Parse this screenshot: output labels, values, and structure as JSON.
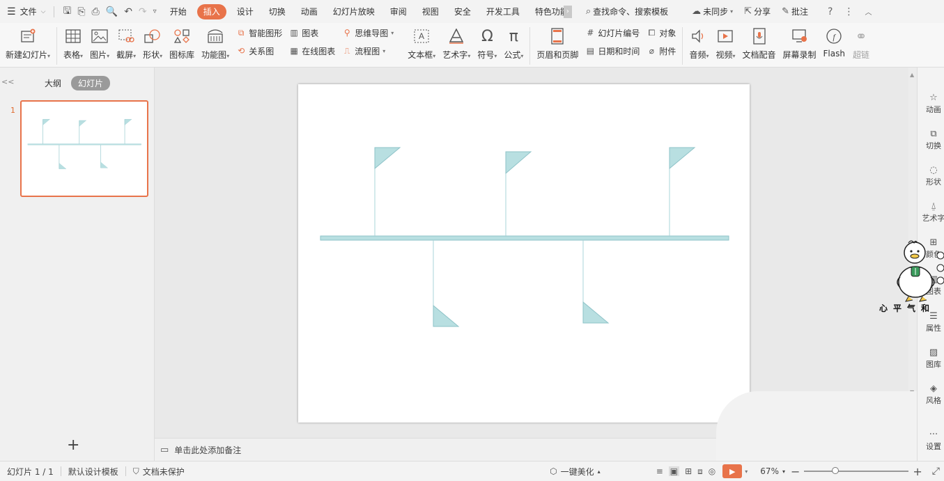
{
  "menubar": {
    "file_label": "文件",
    "tabs": [
      "开始",
      "插入",
      "设计",
      "切换",
      "动画",
      "幻灯片放映",
      "审阅",
      "视图",
      "安全",
      "开发工具",
      "特色功能"
    ],
    "active_tab": "插入",
    "search_label": "查找命令、搜索模板",
    "sync_label": "未同步",
    "share_label": "分享",
    "comment_label": "批注"
  },
  "ribbon": {
    "new_slide": "新建幻灯片",
    "table": "表格",
    "picture": "图片",
    "screenshot": "截屏",
    "shape": "形状",
    "icon_lib": "图标库",
    "function_chart": "功能图",
    "smart_art": "智能图形",
    "chart": "图表",
    "relation": "关系图",
    "online_chart": "在线图表",
    "mind_map": "思维导图",
    "flowchart": "流程图",
    "textbox": "文本框",
    "art_text": "艺术字",
    "symbol": "符号",
    "formula": "公式",
    "header_footer": "页眉和页脚",
    "slide_number": "幻灯片编号",
    "object": "对象",
    "datetime": "日期和时间",
    "attachment": "附件",
    "audio": "音频",
    "video": "视频",
    "doc_dub": "文档配音",
    "screen_rec": "屏幕录制",
    "flash": "Flash",
    "hyperlink": "超链"
  },
  "leftpanel": {
    "collapse_glyph": "<<",
    "tab_outline": "大纲",
    "tab_slides": "幻灯片",
    "slide_number": "1",
    "add_glyph": "+"
  },
  "notes": {
    "placeholder": "单击此处添加备注"
  },
  "rightbar": {
    "items": [
      "动画",
      "切换",
      "形状",
      "艺术字",
      "颜色",
      "图表",
      "属性",
      "图库",
      "风格",
      "设置"
    ]
  },
  "overlay": {
    "mascot_text": "心平气和"
  },
  "status": {
    "slide_count": "幻灯片 1 / 1",
    "template": "默认设计模板",
    "protection": "文档未保护",
    "beautify": "一键美化",
    "zoom": "67%"
  },
  "colors": {
    "accent": "#e8734a",
    "flag_fill": "#b8dfe1",
    "flag_stroke": "#8ec3c8",
    "pole": "#a9d4d8"
  }
}
